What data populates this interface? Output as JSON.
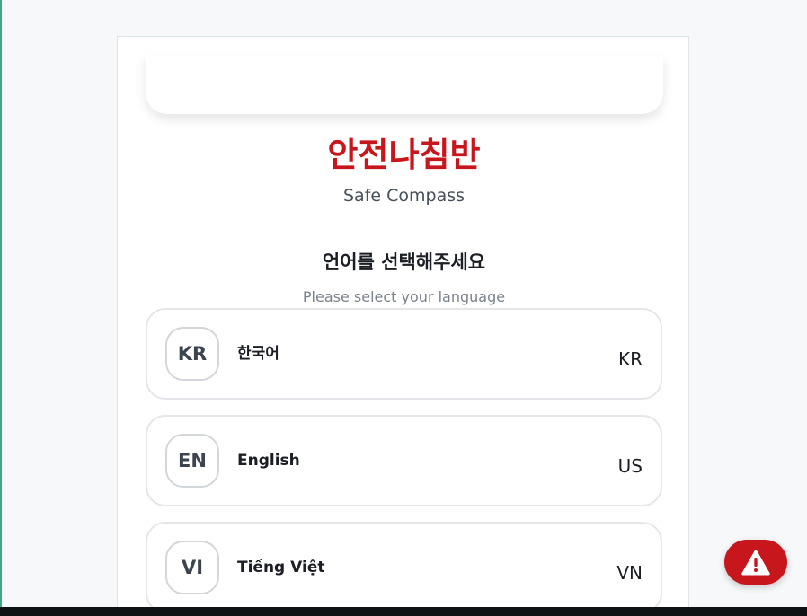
{
  "brand": {
    "title": "안전나침반",
    "subtitle": "Safe Compass"
  },
  "prompt": {
    "korean": "언어를 선택해주세요",
    "english": "Please select your language"
  },
  "languages": [
    {
      "code": "KR",
      "name": "한국어",
      "country": "KR"
    },
    {
      "code": "EN",
      "name": "English",
      "country": "US"
    },
    {
      "code": "VI",
      "name": "Tiếng Việt",
      "country": "VN"
    }
  ],
  "alert_button": {
    "icon": "warning-triangle-icon"
  },
  "colors": {
    "brand_red": "#c8161d",
    "accent_green": "#3fa88a"
  }
}
